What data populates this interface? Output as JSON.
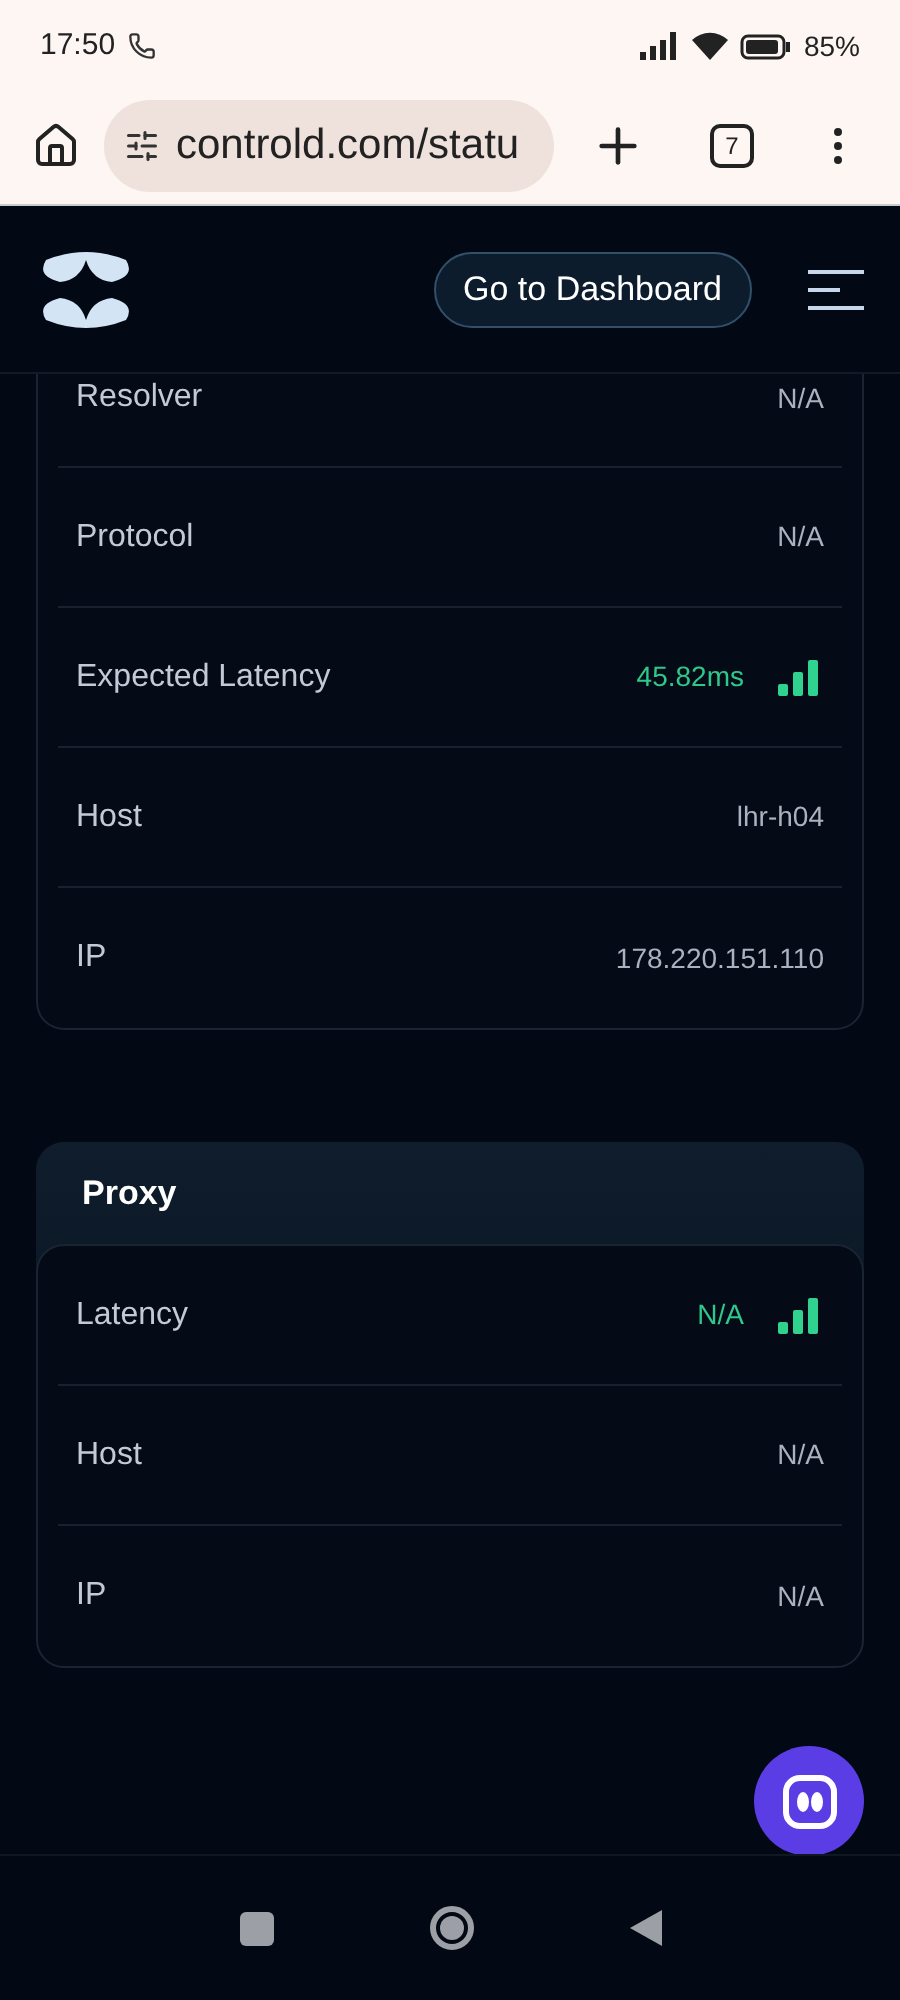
{
  "status_bar": {
    "time": "17:50",
    "battery": "85%"
  },
  "browser": {
    "url": "controld.com/statu",
    "tab_count": "7"
  },
  "header": {
    "dashboard_button": "Go to Dashboard"
  },
  "resolver_card": {
    "rows": [
      {
        "kind": "text",
        "label": "Resolver",
        "value": "N/A"
      },
      {
        "kind": "text",
        "label": "Protocol",
        "value": "N/A"
      },
      {
        "kind": "latency",
        "label": "Expected Latency",
        "value": "45.82ms"
      },
      {
        "kind": "text",
        "label": "Host",
        "value": "lhr-h04"
      },
      {
        "kind": "text",
        "label": "IP",
        "value": "178.220.151.110"
      }
    ]
  },
  "proxy_card": {
    "title": "Proxy",
    "rows": [
      {
        "kind": "latency",
        "label": "Latency",
        "value": "N/A"
      },
      {
        "kind": "text",
        "label": "Host",
        "value": "N/A"
      },
      {
        "kind": "text",
        "label": "IP",
        "value": "N/A"
      }
    ]
  }
}
